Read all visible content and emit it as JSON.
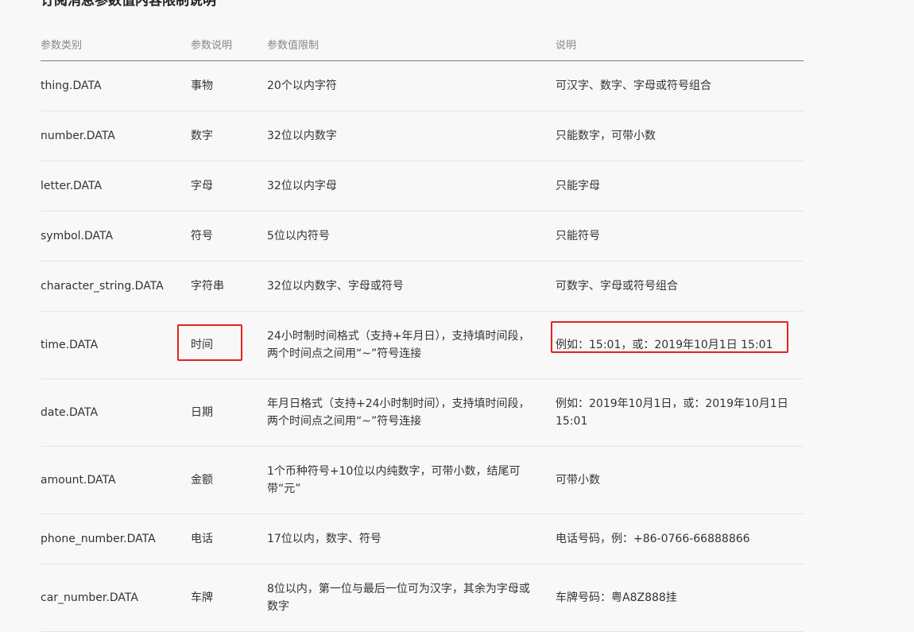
{
  "page": {
    "title": "订阅消息参数值内容限制说明"
  },
  "table": {
    "headers": [
      "参数类别",
      "参数说明",
      "参数值限制",
      "说明"
    ],
    "rows": [
      {
        "type": "thing.DATA",
        "name": "事物",
        "limit": "20个以内字符",
        "desc": "可汉字、数字、字母或符号组合"
      },
      {
        "type": "number.DATA",
        "name": "数字",
        "limit": "32位以内数字",
        "desc": "只能数字，可带小数"
      },
      {
        "type": "letter.DATA",
        "name": "字母",
        "limit": "32位以内字母",
        "desc": "只能字母"
      },
      {
        "type": "symbol.DATA",
        "name": "符号",
        "limit": "5位以内符号",
        "desc": "只能符号"
      },
      {
        "type": "character_string.DATA",
        "name": "字符串",
        "limit": "32位以内数字、字母或符号",
        "desc": "可数字、字母或符号组合"
      },
      {
        "type": "time.DATA",
        "name": "时间",
        "limit": "24小时制时间格式（支持+年月日），支持填时间段，两个时间点之间用“~”符号连接",
        "desc": "例如：15:01，或：2019年10月1日 15:01"
      },
      {
        "type": "date.DATA",
        "name": "日期",
        "limit": "年月日格式（支持+24小时制时间），支持填时间段，两个时间点之间用“~”符号连接",
        "desc": "例如：2019年10月1日，或：2019年10月1日 15:01"
      },
      {
        "type": "amount.DATA",
        "name": "金额",
        "limit": "1个币种符号+10位以内纯数字，可带小数，结尾可带“元”",
        "desc": "可带小数"
      },
      {
        "type": "phone_number.DATA",
        "name": "电话",
        "limit": "17位以内，数字、符号",
        "desc": "电话号码，例：+86-0766-66888866"
      },
      {
        "type": "car_number.DATA",
        "name": "车牌",
        "limit": "8位以内，第一位与最后一位可为汉字，其余为字母或数字",
        "desc": "车牌号码：粤A8Z888挂"
      }
    ]
  },
  "highlight": {
    "color": "#e32222"
  }
}
